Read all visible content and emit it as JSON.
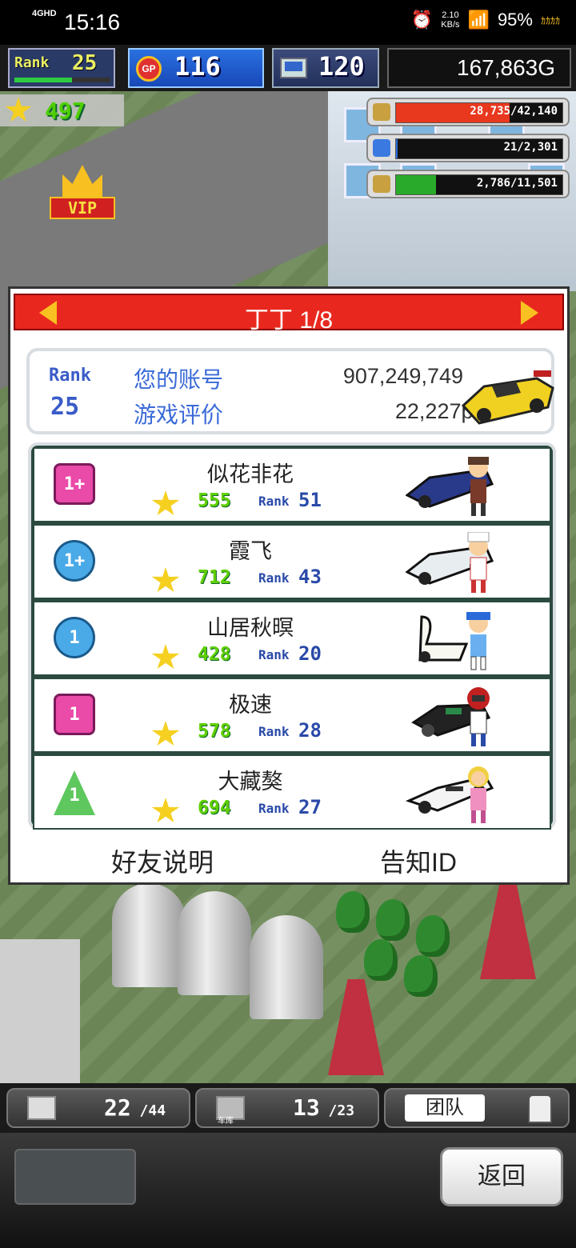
{
  "status_bar": {
    "network": "4GHD",
    "time": "15:16",
    "speed_value": "2.10",
    "speed_unit": "KB/s",
    "battery": "95%",
    "deco": "ｶｶｶｶ"
  },
  "hud": {
    "rank_label": "Rank",
    "rank_value": "25",
    "rank_progress_fraction": 0.6,
    "gp_icon_text": "GP",
    "gp_value": "116",
    "pc_value": "120",
    "money": "167,863G",
    "stars": "497",
    "vip_label": "VIP"
  },
  "resources": [
    {
      "value": "28,735/42,140",
      "color": "#e8381e"
    },
    {
      "value": "21/2,301",
      "color": "#2a6ad8"
    },
    {
      "value": "2,786/11,501",
      "color": "#2aaa2a"
    }
  ],
  "dialog": {
    "title": "丁丁 1/8",
    "profile": {
      "rank_label": "Rank",
      "rank_value": "25",
      "account_label": "您的账号",
      "account_value": "907,249,749",
      "rating_label": "游戏评价",
      "rating_value": "22,227pt"
    },
    "friends": [
      {
        "badge": "1+",
        "badge_style": "pink",
        "name": "似花非花",
        "stars": "555",
        "rank_label": "Rank",
        "rank": "51",
        "vehicle_color": "#2a3a8a",
        "hair": "#5a3a2a"
      },
      {
        "badge": "1+",
        "badge_style": "blue",
        "name": "霞飞",
        "stars": "712",
        "rank_label": "Rank",
        "rank": "43",
        "vehicle_color": "#e8eef0",
        "hair": "#e8a030"
      },
      {
        "badge": "1",
        "badge_style": "blue",
        "name": "山居秋暝",
        "stars": "428",
        "rank_label": "Rank",
        "rank": "20",
        "vehicle_color": "#f8f8f0",
        "hair": "#f0d040"
      },
      {
        "badge": "1",
        "badge_style": "pink",
        "name": "极速",
        "stars": "578",
        "rank_label": "Rank",
        "rank": "28",
        "vehicle_color": "#222",
        "hair": "#c02020"
      },
      {
        "badge": "1",
        "badge_style": "green",
        "name": "大藏獒",
        "stars": "694",
        "rank_label": "Rank",
        "rank": "27",
        "vehicle_color": "#f4f4f4",
        "hair": "#f0d040"
      }
    ],
    "help_button": "好友说明",
    "notify_id_button": "告知ID"
  },
  "tabs": {
    "cars_count": "22",
    "cars_max": "44",
    "garage_label": "车库",
    "garage_count": "13",
    "garage_max": "23",
    "team_label": "团队"
  },
  "actions": {
    "back_label": "返回"
  }
}
